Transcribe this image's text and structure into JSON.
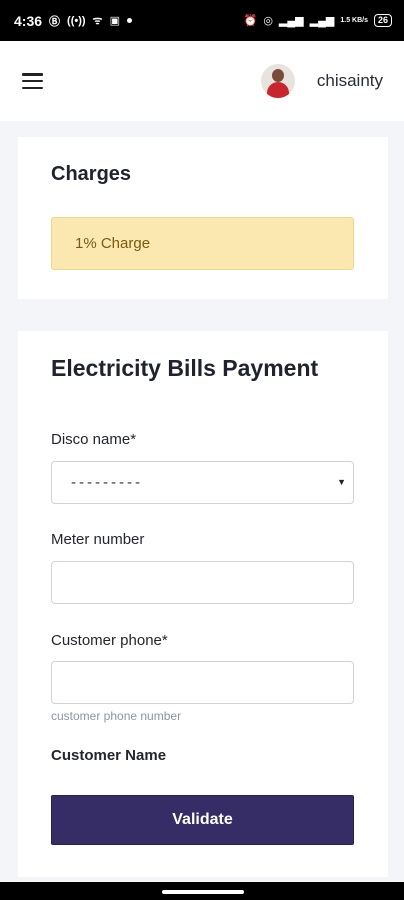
{
  "status_bar": {
    "time": "4:36",
    "left_icons": [
      "notification-b-icon",
      "volte-icon",
      "wifi-calling-icon",
      "sim-icon",
      "dot-icon"
    ],
    "right_icons": [
      "alarm-icon",
      "hotspot-icon",
      "signal-icon",
      "signal-icon",
      "data-speed-icon"
    ],
    "data_speed": "1.5 KB/s",
    "battery": "26"
  },
  "header": {
    "menu_icon": "hamburger-menu-icon",
    "username": "chisainty"
  },
  "charges": {
    "title": "Charges",
    "notice": "1% Charge",
    "notice_bg": "#fbe8b1"
  },
  "form": {
    "title": "Electricity Bills Payment",
    "disco": {
      "label": "Disco name*",
      "selected": "---------"
    },
    "meter": {
      "label": "Meter number",
      "value": ""
    },
    "phone": {
      "label": "Customer phone*",
      "value": "",
      "help": "customer phone number"
    },
    "customer_name_label": "Customer Name",
    "validate_label": "Validate",
    "accent": "#362c66"
  }
}
